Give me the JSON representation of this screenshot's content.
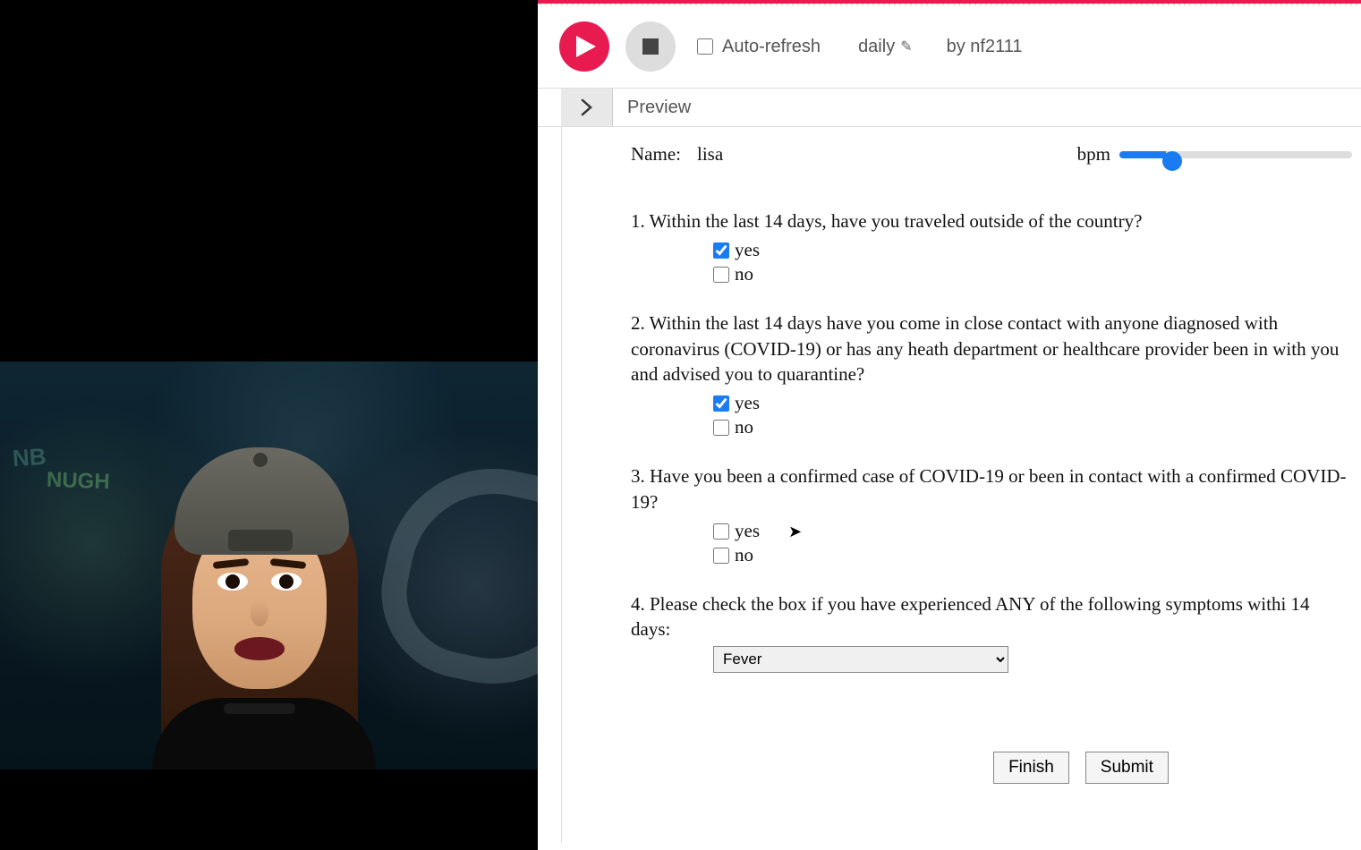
{
  "toolbar": {
    "auto_refresh_label": "Auto-refresh",
    "auto_refresh_checked": false,
    "schedule_label": "daily",
    "byline": "by nf2111"
  },
  "preview": {
    "label": "Preview"
  },
  "form": {
    "name_label": "Name:",
    "name_value": "lisa",
    "bpm_label": "bpm",
    "bpm_value": 20,
    "questions": [
      {
        "text": "1. Within the last 14 days, have you traveled outside of the country?",
        "options": [
          {
            "label": "yes",
            "checked": true
          },
          {
            "label": "no",
            "checked": false
          }
        ]
      },
      {
        "text": "2. Within the last 14 days have you come in close contact with anyone diagnosed with coronavirus (COVID-19) or has any heath department or healthcare provider been in with you and advised you to quarantine?",
        "options": [
          {
            "label": "yes",
            "checked": true
          },
          {
            "label": "no",
            "checked": false
          }
        ]
      },
      {
        "text": "3. Have you been a confirmed case of COVID-19 or been in contact with a confirmed COVID-19?",
        "options": [
          {
            "label": "yes",
            "checked": false
          },
          {
            "label": "no",
            "checked": false
          }
        ]
      },
      {
        "text": "4. Please check the box if you have experienced ANY of the following symptoms withi 14 days:",
        "select_value": "Fever"
      }
    ],
    "buttons": {
      "finish": "Finish",
      "submit": "Submit"
    }
  }
}
